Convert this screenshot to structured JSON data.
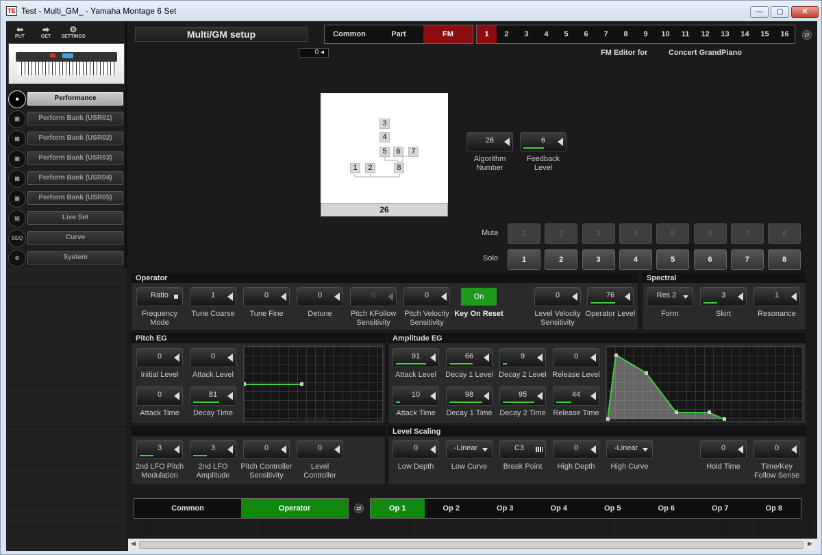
{
  "window": {
    "title": "Test - Multi_GM_ - Yamaha Montage 6 Set",
    "app_icon": "TE",
    "min": "—",
    "max": "▢",
    "close": "✕"
  },
  "toolbar": {
    "put": "PUT",
    "get": "GET",
    "settings": "SETTINGS"
  },
  "sidebar": {
    "items": [
      {
        "label": "Performance",
        "icon": "■",
        "active": true
      },
      {
        "label": "Perform Bank (USR01)",
        "icon": "▦"
      },
      {
        "label": "Perform Bank (USR02)",
        "icon": "▦"
      },
      {
        "label": "Perform Bank (USR03)",
        "icon": "▦"
      },
      {
        "label": "Perform Bank (USR04)",
        "icon": "▦"
      },
      {
        "label": "Perform Bank (USR05)",
        "icon": "▦"
      },
      {
        "label": "Live Set",
        "icon": "▤"
      },
      {
        "label": "Curve",
        "icon": "SEQ"
      },
      {
        "label": "System",
        "icon": "⊕"
      }
    ]
  },
  "page": {
    "title": "Multi/GM setup",
    "small_value": "0",
    "mode_tabs": [
      "Common",
      "Part",
      "FM"
    ],
    "part_numbers": [
      "1",
      "2",
      "3",
      "4",
      "5",
      "6",
      "7",
      "8",
      "9",
      "10",
      "11",
      "12",
      "13",
      "14",
      "15",
      "16"
    ],
    "fm_editor_label": "FM Editor for",
    "voice_name": "Concert GrandPiano"
  },
  "algorithm": {
    "number": "26",
    "ops": [
      "3",
      "4",
      "5",
      "6",
      "7",
      "1",
      "2",
      "8"
    ],
    "algo_knob": "26",
    "algo_label": "Algorithm\nNumber",
    "feedback_knob": "6",
    "feedback_label": "Feedback\nLevel"
  },
  "mute_solo": {
    "mute_label": "Mute",
    "solo_label": "Solo",
    "mute": [
      "1",
      "2",
      "3",
      "4",
      "5",
      "6",
      "7",
      "8"
    ],
    "solo": [
      "1",
      "2",
      "3",
      "4",
      "5",
      "6",
      "7",
      "8"
    ]
  },
  "operator": {
    "title": "Operator",
    "freq_mode": "Ratio",
    "freq_mode_label": "Frequency\nMode",
    "coarse": "1",
    "coarse_label": "Tune Coarse",
    "fine": "0",
    "fine_label": "Tune Fine",
    "detune": "0",
    "detune_label": "Detune",
    "pkf": "0",
    "pkf_label": "Pitch KFollow\nSensitivity",
    "pvs": "0",
    "pvs_label": "Pitch Velocity\nSensitivity",
    "key_on_reset": "On",
    "key_on_reset_label": "Key On Reset",
    "lvs": "0",
    "lvs_label": "Level Velocity\nSensitivity",
    "op_level": "76",
    "op_level_label": "Operator Level"
  },
  "spectral": {
    "title": "Spectral",
    "form": "Res 2",
    "form_label": "Form",
    "skirt": "3",
    "skirt_label": "Skirt",
    "resonance": "1",
    "resonance_label": "Resonance"
  },
  "pitch_eg": {
    "title": "Pitch EG",
    "initial_level": "0",
    "initial_level_label": "Initial Level",
    "attack_level": "0",
    "attack_level_label": "Attack Level",
    "attack_time": "0",
    "attack_time_label": "Attack Time",
    "decay_time": "81",
    "decay_time_label": "Decay Time"
  },
  "amp_eg": {
    "title": "Amplitude EG",
    "attack_level": "91",
    "attack_level_label": "Attack Level",
    "decay1_level": "66",
    "decay1_level_label": "Decay 1 Level",
    "decay2_level": "9",
    "decay2_level_label": "Decay 2 Level",
    "release_level": "0",
    "release_level_label": "Release Level",
    "attack_time": "10",
    "attack_time_label": "Attack Time",
    "decay1_time": "98",
    "decay1_time_label": "Decay 1 Time",
    "decay2_time": "95",
    "decay2_time_label": "Decay 2 Time",
    "release_time": "44",
    "release_time_label": "Release Time"
  },
  "lfo": {
    "pitch_mod": "3",
    "pitch_mod_label": "2nd LFO Pitch\nModulation",
    "amp": "3",
    "amp_label": "2nd LFO\nAmplitude",
    "pcs": "0",
    "pcs_label": "Pitch Controller\nSensitivity",
    "lc": "0",
    "lc_label": "Level\nController"
  },
  "level_scaling": {
    "title": "Level Scaling",
    "low_depth": "0",
    "low_depth_label": "Low Depth",
    "low_curve": "-Linear",
    "low_curve_label": "Low Curve",
    "break_point": "C3",
    "break_point_label": "Break Point",
    "high_depth": "0",
    "high_depth_label": "High Depth",
    "high_curve": "-Linear",
    "high_curve_label": "High Curve",
    "hold_time": "0",
    "hold_time_label": "Hold Time",
    "tk_follow": "0",
    "tk_follow_label": "Time/Key\nFollow Sense"
  },
  "bottom": {
    "common": "Common",
    "operator": "Operator",
    "ops": [
      "Op 1",
      "Op 2",
      "Op 3",
      "Op 4",
      "Op 5",
      "Op 6",
      "Op 7",
      "Op 8"
    ]
  },
  "colors": {
    "accent_red": "#8b0d0d",
    "accent_green": "#1e9a1e"
  }
}
